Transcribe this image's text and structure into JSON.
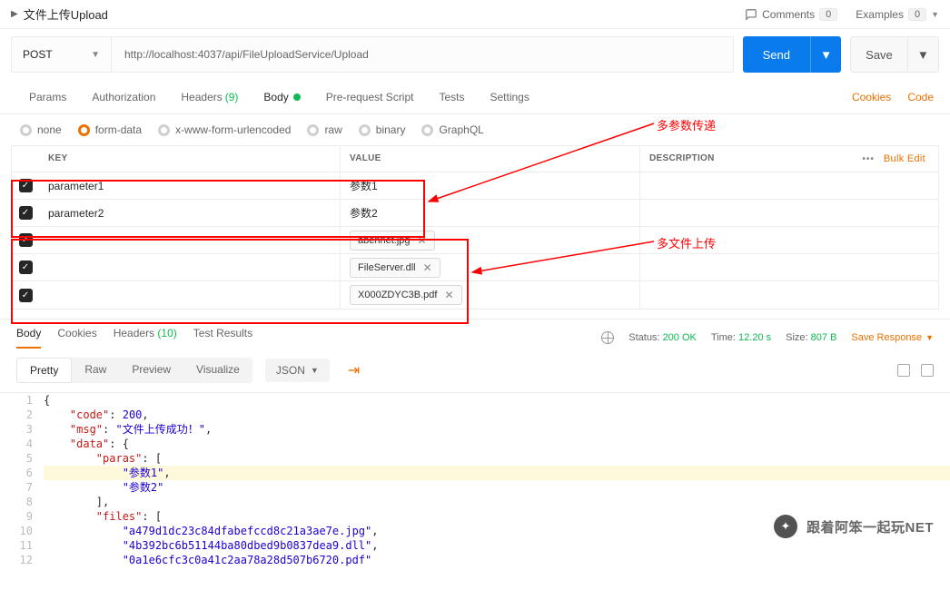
{
  "header": {
    "title": "文件上传Upload",
    "comments_label": "Comments",
    "comments_count": "0",
    "examples_label": "Examples",
    "examples_count": "0"
  },
  "request": {
    "method": "POST",
    "url": "http://localhost:4037/api/FileUploadService/Upload",
    "send_label": "Send",
    "save_label": "Save"
  },
  "tabs": {
    "params": "Params",
    "auth": "Authorization",
    "headers": "Headers",
    "headers_count": "(9)",
    "body": "Body",
    "prs": "Pre-request Script",
    "tests": "Tests",
    "settings": "Settings",
    "cookies": "Cookies",
    "code": "Code"
  },
  "body_types": {
    "none": "none",
    "formdata": "form-data",
    "xwww": "x-www-form-urlencoded",
    "raw": "raw",
    "binary": "binary",
    "graphql": "GraphQL"
  },
  "kv": {
    "h_key": "KEY",
    "h_val": "VALUE",
    "h_desc": "DESCRIPTION",
    "bulk": "Bulk Edit",
    "rows": [
      {
        "key": "parameter1",
        "value": "参数1",
        "file": null
      },
      {
        "key": "parameter2",
        "value": "参数2",
        "file": null
      },
      {
        "key": "",
        "value": "",
        "file": "abennet.jpg"
      },
      {
        "key": "",
        "value": "",
        "file": "FileServer.dll"
      },
      {
        "key": "",
        "value": "",
        "file": "X000ZDYC3B.pdf"
      }
    ]
  },
  "resp_tabs": {
    "body": "Body",
    "cookies": "Cookies",
    "headers": "Headers",
    "headers_count": "(10)",
    "tests": "Test Results"
  },
  "status": {
    "status_label": "Status:",
    "status_value": "200 OK",
    "time_label": "Time:",
    "time_value": "12.20 s",
    "size_label": "Size:",
    "size_value": "807 B",
    "save_resp": "Save Response"
  },
  "view": {
    "pretty": "Pretty",
    "raw": "Raw",
    "preview": "Preview",
    "visualize": "Visualize",
    "lang": "JSON"
  },
  "code_lines": [
    {
      "n": 1,
      "t": "punc",
      "txt": "{"
    },
    {
      "n": 2,
      "t": "kv_num",
      "key": "\"code\"",
      "val": "200",
      "trail": ","
    },
    {
      "n": 3,
      "t": "kv_str",
      "key": "\"msg\"",
      "val": "\"文件上传成功！\"",
      "trail": ","
    },
    {
      "n": 4,
      "t": "kv_open",
      "key": "\"data\"",
      "open": "{"
    },
    {
      "n": 5,
      "t": "kv_open2",
      "key": "\"paras\"",
      "open": "["
    },
    {
      "n": 6,
      "t": "str_hl",
      "val": "\"参数1\"",
      "trail": ","
    },
    {
      "n": 7,
      "t": "str",
      "val": "\"参数2\""
    },
    {
      "n": 8,
      "t": "close",
      "txt": "],"
    },
    {
      "n": 9,
      "t": "kv_open2",
      "key": "\"files\"",
      "open": "["
    },
    {
      "n": 10,
      "t": "str2",
      "val": "\"a479d1dc23c84dfabefccd8c21a3ae7e.jpg\"",
      "trail": ","
    },
    {
      "n": 11,
      "t": "str2",
      "val": "\"4b392bc6b51144ba80dbed9b0837dea9.dll\"",
      "trail": ","
    },
    {
      "n": 12,
      "t": "str2_cut",
      "val": "\"0a1e6cfc3c0a41c2aa78a28d507b6720.pdf\""
    }
  ],
  "annotations": {
    "multi_param": "多参数传递",
    "multi_file": "多文件上传"
  },
  "watermark": "跟着阿笨一起玩NET"
}
